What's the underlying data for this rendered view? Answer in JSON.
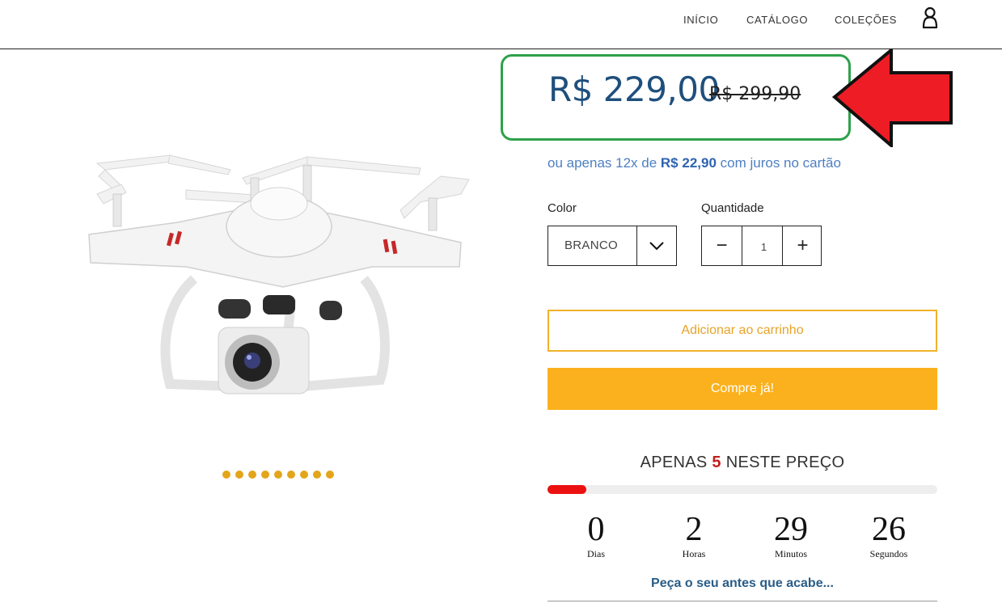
{
  "nav": {
    "items": [
      {
        "label": "INÍCIO"
      },
      {
        "label": "CATÁLOGO"
      },
      {
        "label": "COLEÇÕES"
      }
    ],
    "account_icon": "user-icon"
  },
  "product": {
    "image_icon": "drone-image",
    "gallery_dot_count": 9,
    "gallery_dot_color": "#e3a51a",
    "price": "R$ 229,00",
    "old_price": "R$ 299,90",
    "installments": {
      "prefix": "ou apenas 12x de ",
      "amount": "R$ 22,90",
      "suffix": " com juros no cartão"
    },
    "variant": {
      "label": "Color",
      "value": "BRANCO"
    },
    "quantity": {
      "label": "Quantidade",
      "value": "1",
      "minus": "−",
      "plus": "+"
    },
    "add_to_cart": "Adicionar ao carrinho",
    "buy_now": "Compre já!"
  },
  "scarcity": {
    "prefix": "APENAS ",
    "count": "5",
    "suffix": " NESTE PREÇO",
    "progress_fraction": 0.1,
    "countdown": [
      {
        "value": "0",
        "label": "Dias"
      },
      {
        "value": "2",
        "label": "Horas"
      },
      {
        "value": "29",
        "label": "Minutos"
      },
      {
        "value": "26",
        "label": "Segundos"
      }
    ],
    "hurry_text": "Peça o seu antes que acabe..."
  },
  "colors": {
    "price": "#1f4f7c",
    "highlight_box": "#2ea14a",
    "arrow": "#ee1c25",
    "accent": "#fbb11d",
    "progress": "#ec1111"
  }
}
